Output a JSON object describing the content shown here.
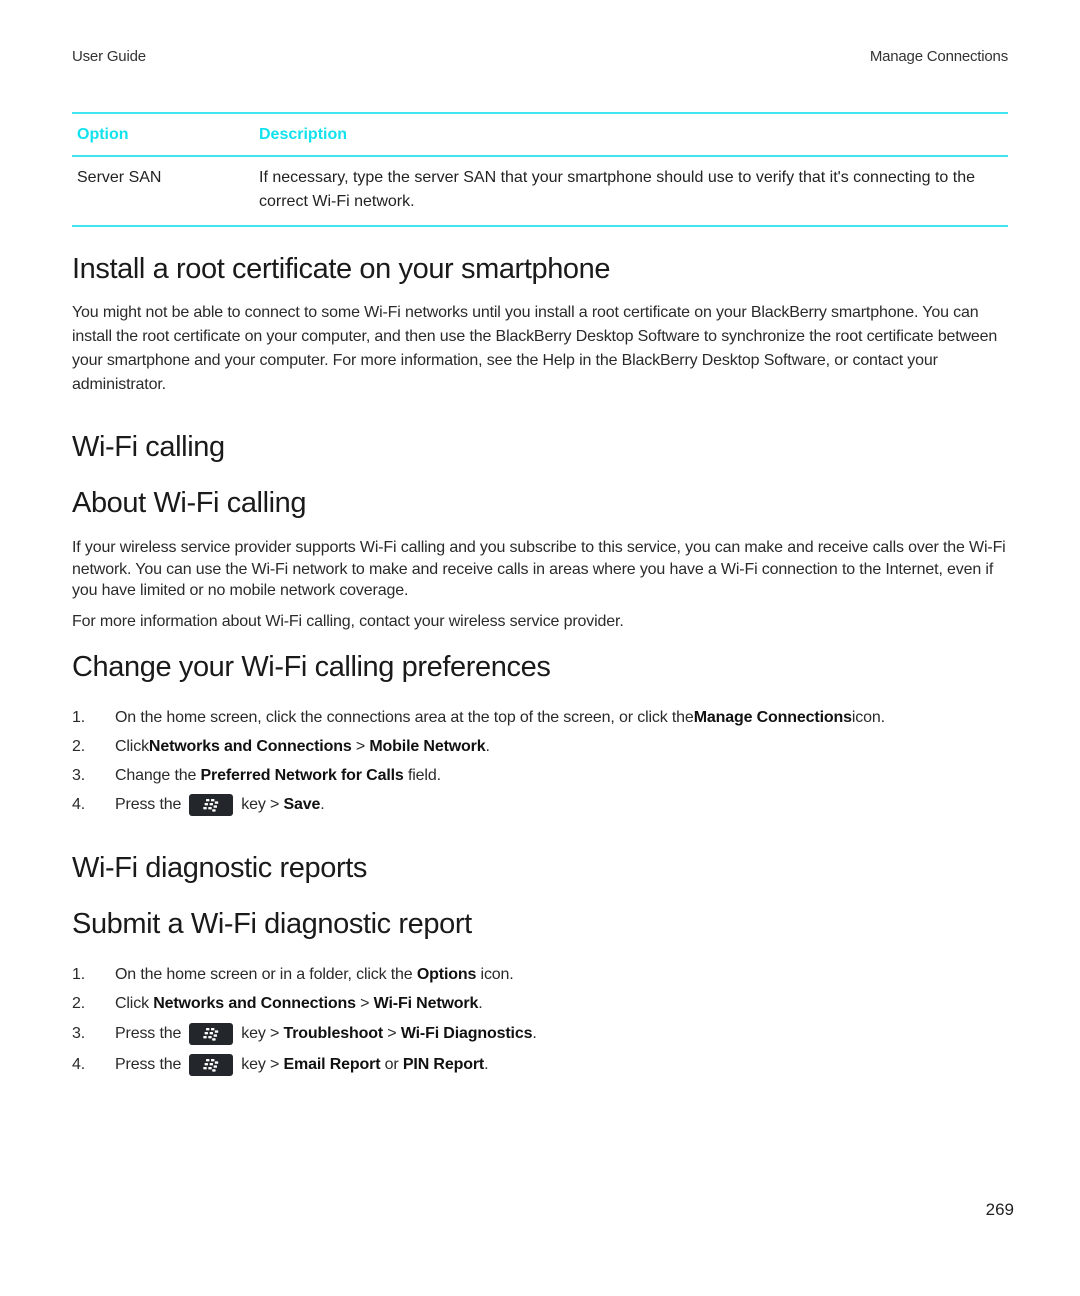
{
  "header": {
    "left": "User Guide",
    "right": "Manage Connections"
  },
  "table": {
    "columns": [
      "Option",
      "Description"
    ],
    "rows": [
      {
        "option": "Server SAN",
        "description": "If necessary, type the server SAN that your smartphone should use to verify that it's connecting to the correct Wi-Fi network."
      }
    ],
    "accent_color": "#12e2ee"
  },
  "sections": {
    "root_cert": {
      "title": "Install a root certificate on your smartphone",
      "body": "You might not be able to connect to some Wi-Fi networks until you install a root certificate on your BlackBerry smartphone. You can install the root certificate on your computer, and then use the BlackBerry Desktop Software to synchronize the root certificate between your smartphone and your computer. For more information, see the Help in the BlackBerry Desktop Software, or contact your administrator."
    },
    "wifi_calling": {
      "title": "Wi-Fi calling"
    },
    "about_wifi_calling": {
      "title": "About Wi-Fi calling",
      "body1": "If your wireless service provider supports Wi-Fi calling and you subscribe to this service, you can make and receive calls over the Wi-Fi network. You can use the Wi-Fi network to make and receive calls in areas where you have a Wi-Fi connection to the Internet, even if you have limited or no mobile network coverage.",
      "body2": "For more information about Wi-Fi calling, contact your wireless service provider."
    },
    "change_prefs": {
      "title": "Change your Wi-Fi calling preferences",
      "steps": [
        {
          "num": "1.",
          "pre": "On the home screen, click the connections area at the top of the screen, or click the ",
          "b1": "Manage Connections",
          "post": " icon."
        },
        {
          "num": "2.",
          "pre": "Click ",
          "b1": "Networks and Connections",
          "sep": " > ",
          "b2": "Mobile Network",
          "post": "."
        },
        {
          "num": "3.",
          "pre": "Change the ",
          "b1": "Preferred Network for Calls",
          "post": " field."
        },
        {
          "num": "4.",
          "pre": "Press the",
          "key": "blackberry-menu-key",
          "mid": "key > ",
          "b1": "Save",
          "post": "."
        }
      ]
    },
    "diag_reports": {
      "title": "Wi-Fi diagnostic reports"
    },
    "submit_diag": {
      "title": "Submit a Wi-Fi diagnostic report",
      "steps": [
        {
          "num": "1.",
          "pre": "On the home screen or in a folder, click the ",
          "b1": "Options",
          "post": " icon."
        },
        {
          "num": "2.",
          "pre": "Click ",
          "b1": "Networks and Connections",
          "sep": " > ",
          "b2": "Wi-Fi Network",
          "post": "."
        },
        {
          "num": "3.",
          "pre": "Press the",
          "key": "blackberry-menu-key",
          "mid": "key > ",
          "b1": "Troubleshoot",
          "sep": " > ",
          "b2": "Wi-Fi Diagnostics",
          "post": "."
        },
        {
          "num": "4.",
          "pre": "Press the",
          "key": "blackberry-menu-key",
          "mid": "key > ",
          "b1": "Email Report",
          "sep": " or ",
          "b2": "PIN Report",
          "post": "."
        }
      ]
    }
  },
  "page_number": "269"
}
